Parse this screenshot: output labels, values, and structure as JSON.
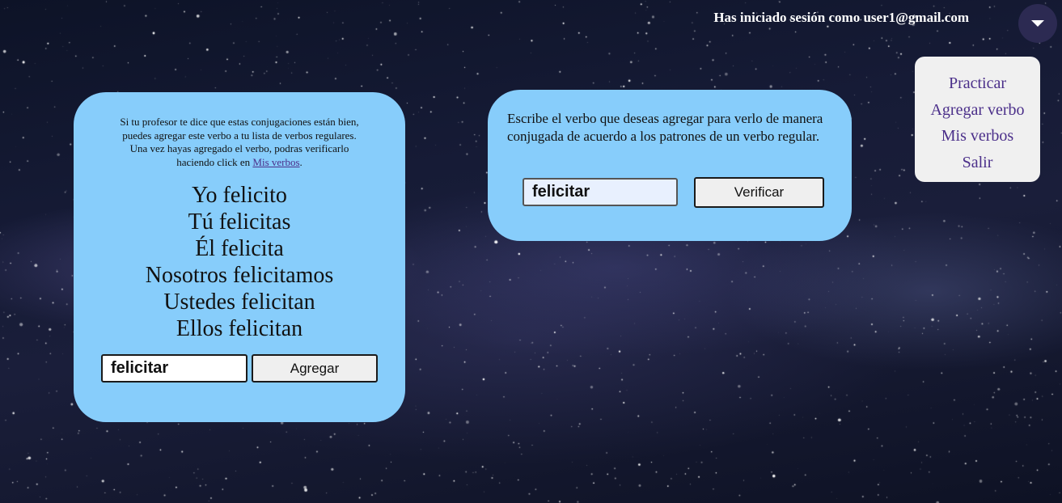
{
  "header": {
    "user_text": "Has iniciado sesión como user1@gmail.com",
    "menu_toggle_icon": "caret-down-icon"
  },
  "menu": {
    "items": [
      {
        "label": "Practicar"
      },
      {
        "label": "Agregar verbo"
      },
      {
        "label": "Mis verbos"
      },
      {
        "label": "Salir"
      }
    ],
    "link_color": "#4b2f8a"
  },
  "result_card": {
    "info_text": "Si tu profesor te dice que estas conjugaciones están bien, puedes agregar este verbo a tu lista de verbos regulares. Una vez hayas agregado el verbo, podras verificarlo haciendo click en ",
    "info_link": "Mis verbos",
    "info_end": ".",
    "conjugations": [
      "Yo felicito",
      "Tú felicitas",
      "Él felicita",
      "Nosotros felicitamos",
      "Ustedes felicitan",
      "Ellos felicitan"
    ],
    "verb_value": "felicitar",
    "add_button": "Agregar"
  },
  "verify_card": {
    "description": "Escribe el verbo que deseas agregar para verlo de manera conjugada de acuerdo a los patrones de un verbo regular.",
    "verb_value": "felicitar",
    "verify_button": "Verificar"
  },
  "colors": {
    "card_bg": "#87cdfb",
    "menu_bg": "#f0f0f0",
    "toggle_bg": "#2c2a52"
  }
}
